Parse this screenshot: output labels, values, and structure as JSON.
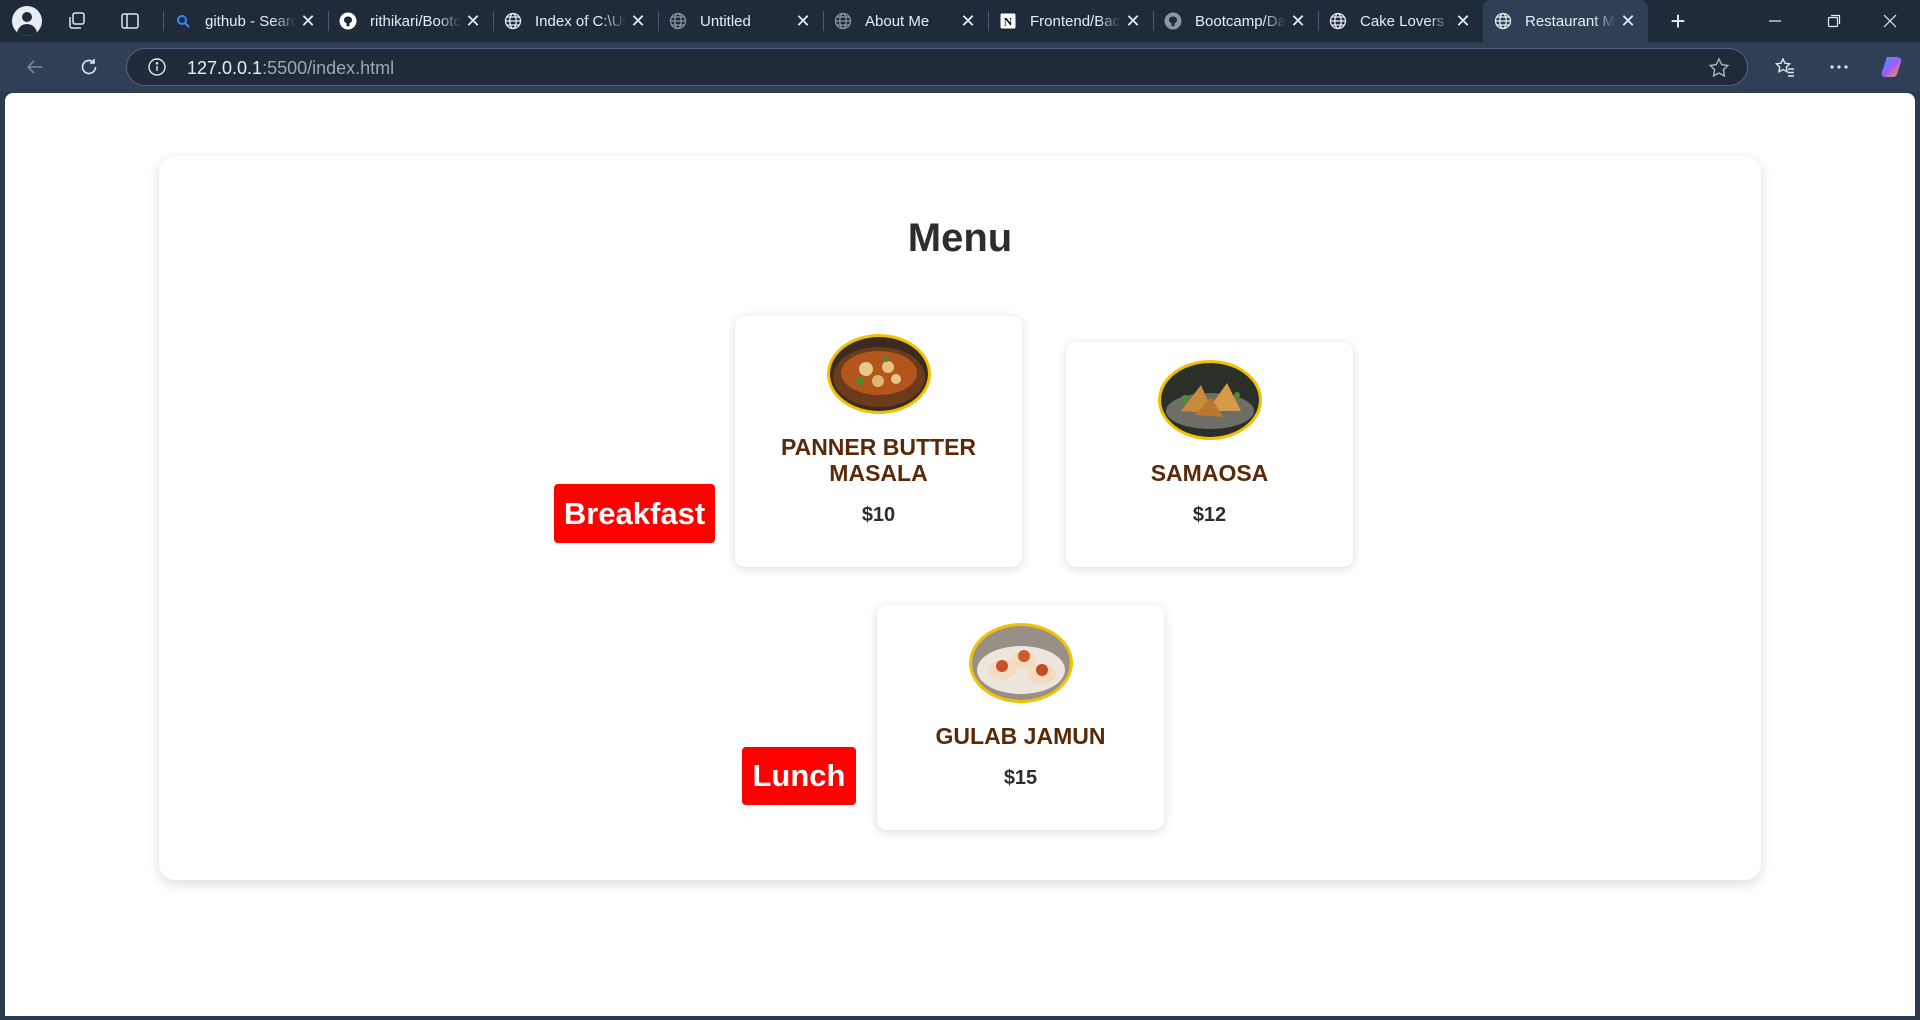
{
  "browser": {
    "tabs": [
      {
        "title": "github - Search",
        "favicon": "search-icon",
        "active": false
      },
      {
        "title": "rithikari/Bootcamp",
        "favicon": "github-icon",
        "active": false
      },
      {
        "title": "Index of C:\\Users",
        "favicon": "globe-icon",
        "active": false
      },
      {
        "title": "Untitled",
        "favicon": "globe-icon",
        "active": false
      },
      {
        "title": "About Me",
        "favicon": "globe-icon",
        "active": false
      },
      {
        "title": "Frontend/Backend",
        "favicon": "notion-icon",
        "active": false
      },
      {
        "title": "Bootcamp/Day",
        "favicon": "github-icon",
        "active": false
      },
      {
        "title": "Cake Lovers Bakery",
        "favicon": "globe-icon",
        "active": false
      },
      {
        "title": "Restaurant Menu",
        "favicon": "globe-icon",
        "active": true
      }
    ],
    "address": {
      "host": "127.0.0.1",
      "path": ":5500/index.html"
    }
  },
  "page": {
    "title": "Menu",
    "categories": [
      {
        "label": "Breakfast"
      },
      {
        "label": "Lunch"
      }
    ],
    "items": [
      {
        "name": "PANNER BUTTER MASALA",
        "price": "$10",
        "image": "curry-bowl-image"
      },
      {
        "name": "SAMAOSA",
        "price": "$12",
        "image": "samosa-plate-image"
      },
      {
        "name": "GULAB JAMUN",
        "price": "$15",
        "image": "dessert-plate-image"
      }
    ],
    "colors": {
      "badge": "#ff0000",
      "item_name": "#5a2a08",
      "image_border": "#f2c200"
    }
  }
}
